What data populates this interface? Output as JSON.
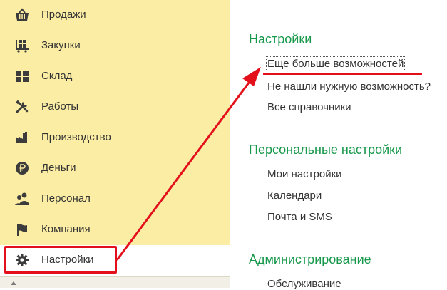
{
  "sidebar": {
    "items": [
      {
        "label": "Продажи",
        "icon": "basket-icon"
      },
      {
        "label": "Закупки",
        "icon": "cart-icon"
      },
      {
        "label": "Склад",
        "icon": "warehouse-grid-icon"
      },
      {
        "label": "Работы",
        "icon": "tools-icon"
      },
      {
        "label": "Производство",
        "icon": "factory-icon"
      },
      {
        "label": "Деньги",
        "icon": "ruble-coin-icon"
      },
      {
        "label": "Персонал",
        "icon": "people-icon"
      },
      {
        "label": "Компания",
        "icon": "flag-icon"
      },
      {
        "label": "Настройки",
        "icon": "gear-icon",
        "active": true
      }
    ]
  },
  "main": {
    "sections": [
      {
        "title": "Настройки",
        "links": [
          "Еще больше возможностей",
          "Не нашли нужную возможность?",
          "Все справочники"
        ]
      },
      {
        "title": "Персональные настройки",
        "links": [
          "Мои настройки",
          "Календари",
          "Почта и SMS"
        ]
      },
      {
        "title": "Администрирование",
        "links": [
          "Обслуживание"
        ]
      }
    ]
  },
  "colors": {
    "sidebar_bg": "#fbeda4",
    "section_title": "#17984b",
    "annotation_red": "#e3101b",
    "icon_dark": "#3c3c3c"
  }
}
